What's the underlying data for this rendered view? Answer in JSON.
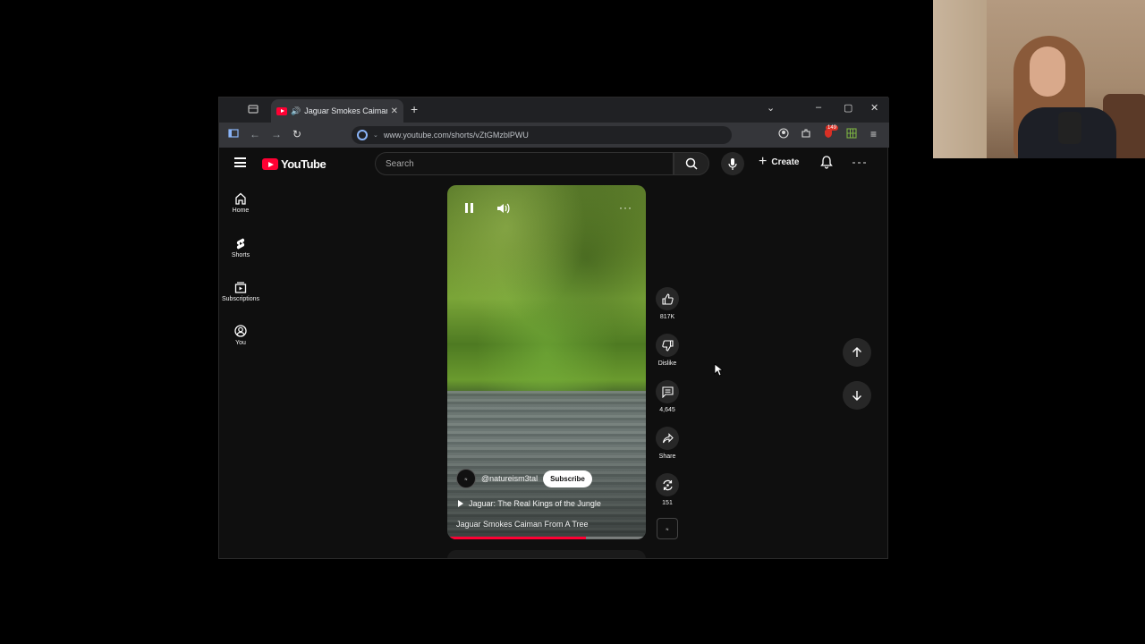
{
  "browser": {
    "tab_title": "Jaguar Smokes Caiman Fro...",
    "url": "www.youtube.com/shorts/vZtGMzblPWU",
    "extension_badge": "149"
  },
  "youtube": {
    "logo_text": "YouTube",
    "search_placeholder": "Search",
    "create_label": "Create",
    "nav": [
      {
        "label": "Home"
      },
      {
        "label": "Shorts"
      },
      {
        "label": "Subscriptions"
      },
      {
        "label": "You"
      }
    ]
  },
  "short": {
    "channel_handle": "@natureism3tal",
    "subscribe_label": "Subscribe",
    "playlist_title": "Jaguar: The Real Kings of the Jungle",
    "video_title": "Jaguar Smokes Caiman From A Tree",
    "progress": 0.7,
    "likes": "817K",
    "dislike_label": "Dislike",
    "comments": "4,645",
    "share_label": "Share",
    "remix_count": "151"
  },
  "colors": {
    "brand_red": "#ff0033",
    "page_bg": "#0f0f0f"
  }
}
